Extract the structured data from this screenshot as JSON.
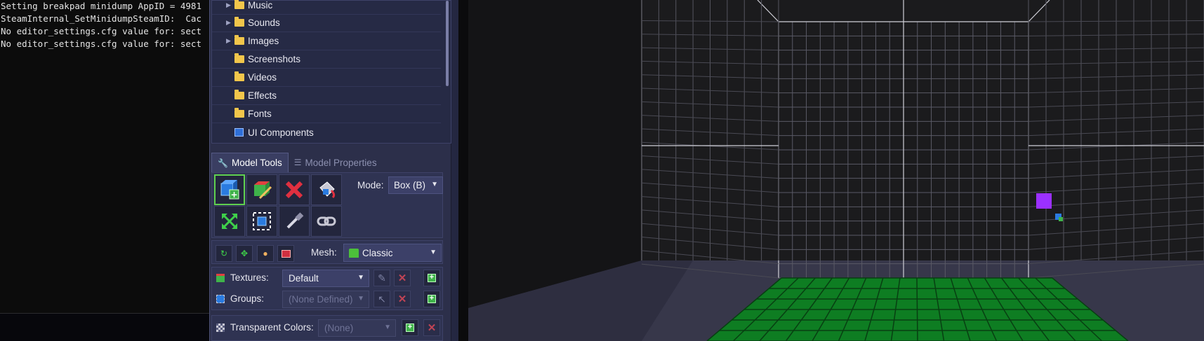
{
  "console": {
    "lines": [
      "Setting breakpad minidump AppID = 4981",
      "SteamInternal_SetMinidumpSteamID:  Cac",
      "No editor_settings.cfg value for: sect",
      "No editor_settings.cfg value for: sect"
    ]
  },
  "tree": {
    "items": [
      {
        "label": "Music",
        "expandable": true
      },
      {
        "label": "Sounds",
        "expandable": true
      },
      {
        "label": "Images",
        "expandable": true
      },
      {
        "label": "Screenshots",
        "expandable": false
      },
      {
        "label": "Videos",
        "expandable": false
      },
      {
        "label": "Effects",
        "expandable": false
      },
      {
        "label": "Fonts",
        "expandable": false
      },
      {
        "label": "UI Components",
        "expandable": false
      }
    ]
  },
  "tabs": [
    {
      "label": "Model Tools",
      "active": true
    },
    {
      "label": "Model Properties",
      "active": false
    }
  ],
  "tools": {
    "mode_label": "Mode:",
    "mode_value": "Box (B)",
    "buttons": [
      "add-box",
      "paint-box",
      "delete",
      "paint-bucket",
      "expand",
      "select",
      "eyedropper",
      "link"
    ]
  },
  "mesh": {
    "label": "Mesh:",
    "value": "Classic"
  },
  "properties": {
    "textures_label": "Textures:",
    "textures_value": "Default",
    "groups_label": "Groups:",
    "groups_value": "(None Defined)",
    "transparent_label": "Transparent Colors:",
    "transparent_value": "(None)"
  },
  "colors": {
    "panel": "#2c2f4a",
    "accent_green": "#5fd04f",
    "floor_green": "#0f8a2a",
    "cursor_box": "#9b30ff"
  }
}
